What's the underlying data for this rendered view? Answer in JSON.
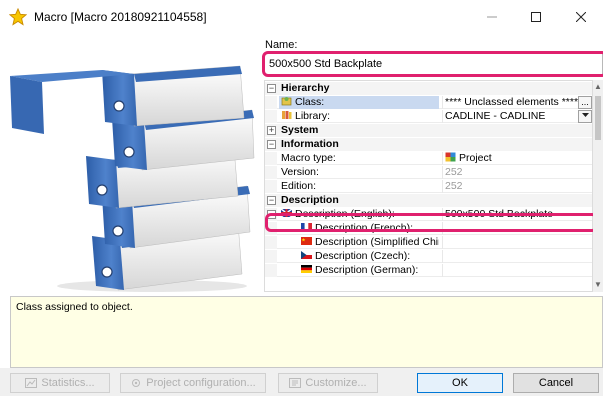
{
  "window": {
    "title": "Macro [Macro 20180921104558]",
    "icon": "star-icon"
  },
  "name_section": {
    "label": "Name:",
    "value": "500x500 Std Backplate"
  },
  "property_grid": {
    "rows": [
      {
        "type": "category",
        "label": "Hierarchy",
        "expanded": true
      },
      {
        "type": "property",
        "icon": "class-icon",
        "name": "Class:",
        "value": "**** Unclassed elements ****",
        "selected": true,
        "control": "ellipsis"
      },
      {
        "type": "property",
        "icon": "library-icon",
        "name": "Library:",
        "value": "CADLINE - CADLINE",
        "control": "dropdown"
      },
      {
        "type": "category",
        "label": "System",
        "expanded": false
      },
      {
        "type": "category",
        "label": "Information",
        "expanded": true
      },
      {
        "type": "property",
        "name": "Macro type:",
        "icon_value": "project-icon",
        "value": "Project"
      },
      {
        "type": "property",
        "name": "Version:",
        "value": "252",
        "dim": true
      },
      {
        "type": "property",
        "name": "Edition:",
        "value": "252",
        "dim": true
      },
      {
        "type": "category",
        "label": "Description",
        "expanded": true
      },
      {
        "type": "property",
        "icon": "flag-english-icon",
        "name": "Description (English):",
        "value": "500x500 Std Backplate",
        "subexpander": true
      },
      {
        "type": "subproperty",
        "icon": "flag-french-icon",
        "name": "Description (French):",
        "value": ""
      },
      {
        "type": "subproperty",
        "icon": "flag-chinese-icon",
        "name": "Description (Simplified Chinese",
        "value": ""
      },
      {
        "type": "subproperty",
        "icon": "flag-czech-icon",
        "name": "Description (Czech):",
        "value": ""
      },
      {
        "type": "subproperty",
        "icon": "flag-german-icon",
        "name": "Description (German):",
        "value": ""
      }
    ]
  },
  "info_panel": {
    "text": "Class assigned to object."
  },
  "buttons": {
    "statistics": "Statistics...",
    "project_configuration": "Project configuration...",
    "customize": "Customize...",
    "ok": "OK",
    "cancel": "Cancel"
  },
  "colors": {
    "highlight": "#e0206e",
    "info_background": "#ffffe5",
    "binder_blue": "#3f6fb8"
  }
}
